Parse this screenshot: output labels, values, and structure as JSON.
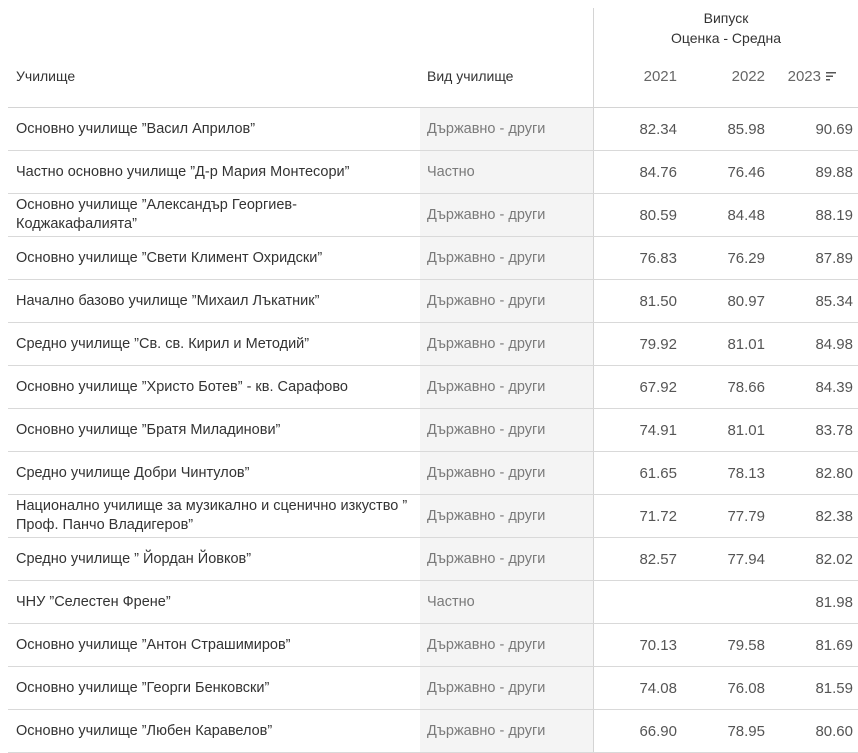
{
  "header": {
    "school_label": "Училище",
    "type_label": "Вид училище",
    "group_line1": "Випуск",
    "group_line2": "Оценка - Средна",
    "years": [
      "2021",
      "2022",
      "2023"
    ],
    "sort_icon": "sort-descending-icon"
  },
  "rows": [
    {
      "school": "Основно училище ”Васил Априлов”",
      "type": "Държавно - други",
      "v2021": "82.34",
      "v2022": "85.98",
      "v2023": "90.69"
    },
    {
      "school": "Частно основно училище ”Д-р Мария Монтесори”",
      "type": "Частно",
      "v2021": "84.76",
      "v2022": "76.46",
      "v2023": "89.88"
    },
    {
      "school": "Основно училище ”Александър Георгиев-Коджакафалията”",
      "type": "Държавно - други",
      "v2021": "80.59",
      "v2022": "84.48",
      "v2023": "88.19"
    },
    {
      "school": "Основно училище ”Свети Климент Охридски”",
      "type": "Държавно - други",
      "v2021": "76.83",
      "v2022": "76.29",
      "v2023": "87.89"
    },
    {
      "school": "Начално базово училище ”Михаил Лъкатник”",
      "type": "Държавно - други",
      "v2021": "81.50",
      "v2022": "80.97",
      "v2023": "85.34"
    },
    {
      "school": "Средно училище ”Св. св. Кирил и Методий”",
      "type": "Държавно - други",
      "v2021": "79.92",
      "v2022": "81.01",
      "v2023": "84.98"
    },
    {
      "school": "Основно училище ”Христо Ботев” - кв. Сарафово",
      "type": "Държавно - други",
      "v2021": "67.92",
      "v2022": "78.66",
      "v2023": "84.39"
    },
    {
      "school": "Основно училище ”Братя Миладинови”",
      "type": "Държавно - други",
      "v2021": "74.91",
      "v2022": "81.01",
      "v2023": "83.78"
    },
    {
      "school": "Средно училище Добри Чинтулов”",
      "type": "Държавно - други",
      "v2021": "61.65",
      "v2022": "78.13",
      "v2023": "82.80"
    },
    {
      "school": "Национално училище за музикално и сценично изкуство ” Проф. Панчо Владигеров”",
      "type": "Държавно - други",
      "v2021": "71.72",
      "v2022": "77.79",
      "v2023": "82.38"
    },
    {
      "school": "Средно училище ” Йордан Йовков”",
      "type": "Държавно - други",
      "v2021": "82.57",
      "v2022": "77.94",
      "v2023": "82.02"
    },
    {
      "school": "ЧНУ ”Селестен Френе”",
      "type": "Частно",
      "v2021": "",
      "v2022": "",
      "v2023": "81.98"
    },
    {
      "school": "Основно училище ”Антон Страшимиров”",
      "type": "Държавно - други",
      "v2021": "70.13",
      "v2022": "79.58",
      "v2023": "81.69"
    },
    {
      "school": "Основно училище ”Георги Бенковски”",
      "type": "Държавно - други",
      "v2021": "74.08",
      "v2022": "76.08",
      "v2023": "81.59"
    },
    {
      "school": "Основно училище ”Любен Каравелов”",
      "type": "Държавно - други",
      "v2021": "66.90",
      "v2022": "78.95",
      "v2023": "80.60"
    }
  ]
}
